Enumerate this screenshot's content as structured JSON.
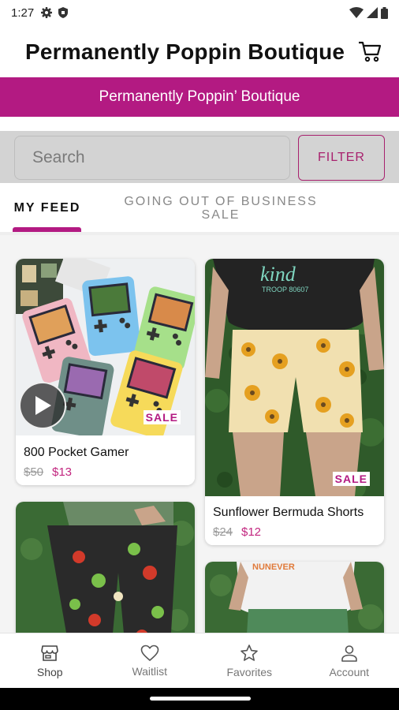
{
  "status_bar": {
    "time": "1:27",
    "left_icons": [
      "gear-icon",
      "shield-icon"
    ],
    "right_icons": [
      "wifi-icon",
      "signal-icon",
      "battery-icon"
    ]
  },
  "header": {
    "title": "Permanently Poppin Boutique",
    "cart_icon": "cart-icon"
  },
  "banner": {
    "text": "Permanently Poppin’ Boutique",
    "color": "#b31a82"
  },
  "search": {
    "placeholder": "Search",
    "filter_label": "FILTER"
  },
  "tabs": [
    {
      "label": "MY FEED",
      "active": true
    },
    {
      "label": "GOING OUT OF BUSINESS SALE",
      "active": false
    }
  ],
  "products": [
    {
      "title": "800 Pocket Gamer",
      "old_price": "$50",
      "new_price": "$13",
      "tag": "SALE",
      "has_video": true
    },
    {
      "title": "Sunflower Bermuda Shorts",
      "old_price": "$24",
      "new_price": "$12",
      "tag": "SALE",
      "has_video": false
    },
    {
      "title": "",
      "old_price": "",
      "new_price": "",
      "tag": "",
      "has_video": false
    },
    {
      "title": "",
      "old_price": "",
      "new_price": "",
      "tag": "",
      "has_video": false
    }
  ],
  "bottom_nav": [
    {
      "label": "Shop",
      "icon": "store-icon",
      "active": true
    },
    {
      "label": "Waitlist",
      "icon": "heart-icon",
      "active": false
    },
    {
      "label": "Favorites",
      "icon": "star-icon",
      "active": false
    },
    {
      "label": "Account",
      "icon": "person-icon",
      "active": false
    }
  ],
  "colors": {
    "accent": "#b31a82",
    "sale_price": "#c2267f",
    "search_bg": "#d3d3d3"
  }
}
